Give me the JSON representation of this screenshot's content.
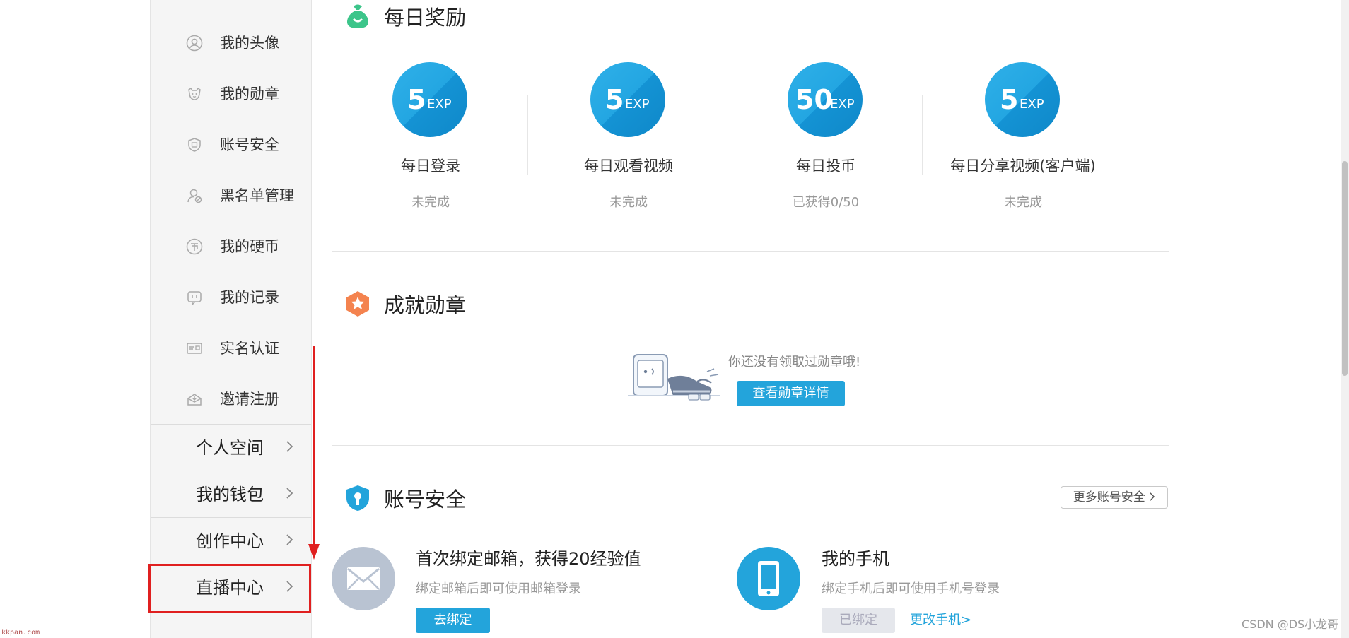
{
  "sidebar": {
    "items": [
      {
        "label": "我的头像",
        "icon": "avatar-icon"
      },
      {
        "label": "我的勋章",
        "icon": "medal-icon"
      },
      {
        "label": "账号安全",
        "icon": "shield-icon"
      },
      {
        "label": "黑名单管理",
        "icon": "blacklist-icon"
      },
      {
        "label": "我的硬币",
        "icon": "coin-icon"
      },
      {
        "label": "我的记录",
        "icon": "record-icon"
      },
      {
        "label": "实名认证",
        "icon": "id-card-icon"
      },
      {
        "label": "邀请注册",
        "icon": "invite-icon"
      }
    ],
    "sections": [
      {
        "label": "个人空间"
      },
      {
        "label": "我的钱包"
      },
      {
        "label": "创作中心"
      },
      {
        "label": "直播中心",
        "highlighted": true
      }
    ]
  },
  "daily_rewards": {
    "title": "每日奖励",
    "items": [
      {
        "amount": "5",
        "unit": "EXP",
        "label": "每日登录",
        "status": "未完成"
      },
      {
        "amount": "5",
        "unit": "EXP",
        "label": "每日观看视频",
        "status": "未完成"
      },
      {
        "amount": "50",
        "unit": "EXP",
        "label": "每日投币",
        "status": "已获得0/50"
      },
      {
        "amount": "5",
        "unit": "EXP",
        "label": "每日分享视频(客户端)",
        "status": "未完成"
      }
    ]
  },
  "achievements": {
    "title": "成就勋章",
    "empty_text": "你还没有领取过勋章哦!",
    "button_label": "查看勋章详情"
  },
  "account_security": {
    "title": "账号安全",
    "more_label": "更多账号安全",
    "email": {
      "title": "首次绑定邮箱，获得20经验值",
      "desc": "绑定邮箱后即可使用邮箱登录",
      "button_label": "去绑定"
    },
    "phone": {
      "title": "我的手机",
      "desc": "绑定手机后即可使用手机号登录",
      "bound_label": "已绑定",
      "change_label": "更改手机>"
    }
  },
  "watermarks": {
    "left": "kkpan.com",
    "right": "CSDN @DS小龙哥"
  },
  "colors": {
    "accent_blue": "#23a4db",
    "highlight_red": "#e02020",
    "daily_icon_green": "#3cc58a",
    "achievement_icon_orange": "#f4834f"
  }
}
